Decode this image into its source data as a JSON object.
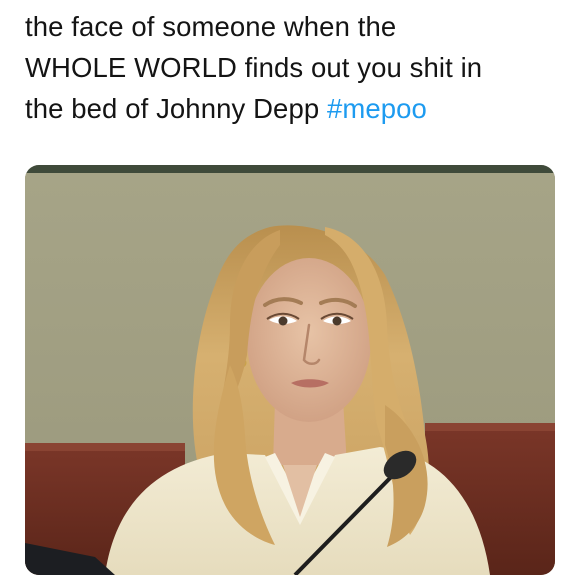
{
  "post": {
    "line1": "the face of someone when the",
    "line2": "WHOLE WORLD finds out you shit in",
    "line3_prefix": "the bed of Johnny Depp ",
    "hashtag": "#mepoo",
    "hashtag_color": "#1d9bf0",
    "text_color": "#141414"
  },
  "media": {
    "description_icon": "photo",
    "wall_color": "#a3a184",
    "panel_color": "#6b2f22",
    "hair_color": "#d3ad6a",
    "jacket_color": "#efe8cf"
  }
}
